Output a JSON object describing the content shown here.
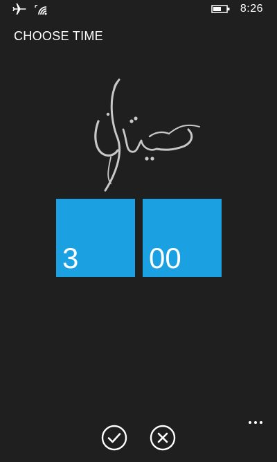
{
  "status_bar": {
    "clock": "8:26",
    "icons": [
      "airplane-mode-icon",
      "wifi-icon",
      "battery-icon"
    ]
  },
  "header": {
    "title": "CHOOSE TIME"
  },
  "logo": {
    "icon": "arabic-calligraphy-logo"
  },
  "picker": {
    "hours": "3",
    "minutes": "00"
  },
  "app_bar": {
    "buttons": [
      "check-icon",
      "close-icon"
    ],
    "more": "ellipsis-icon"
  },
  "colors": {
    "background": "#1f1f1f",
    "accent": "#1ba1e2",
    "text": "#ffffff"
  }
}
